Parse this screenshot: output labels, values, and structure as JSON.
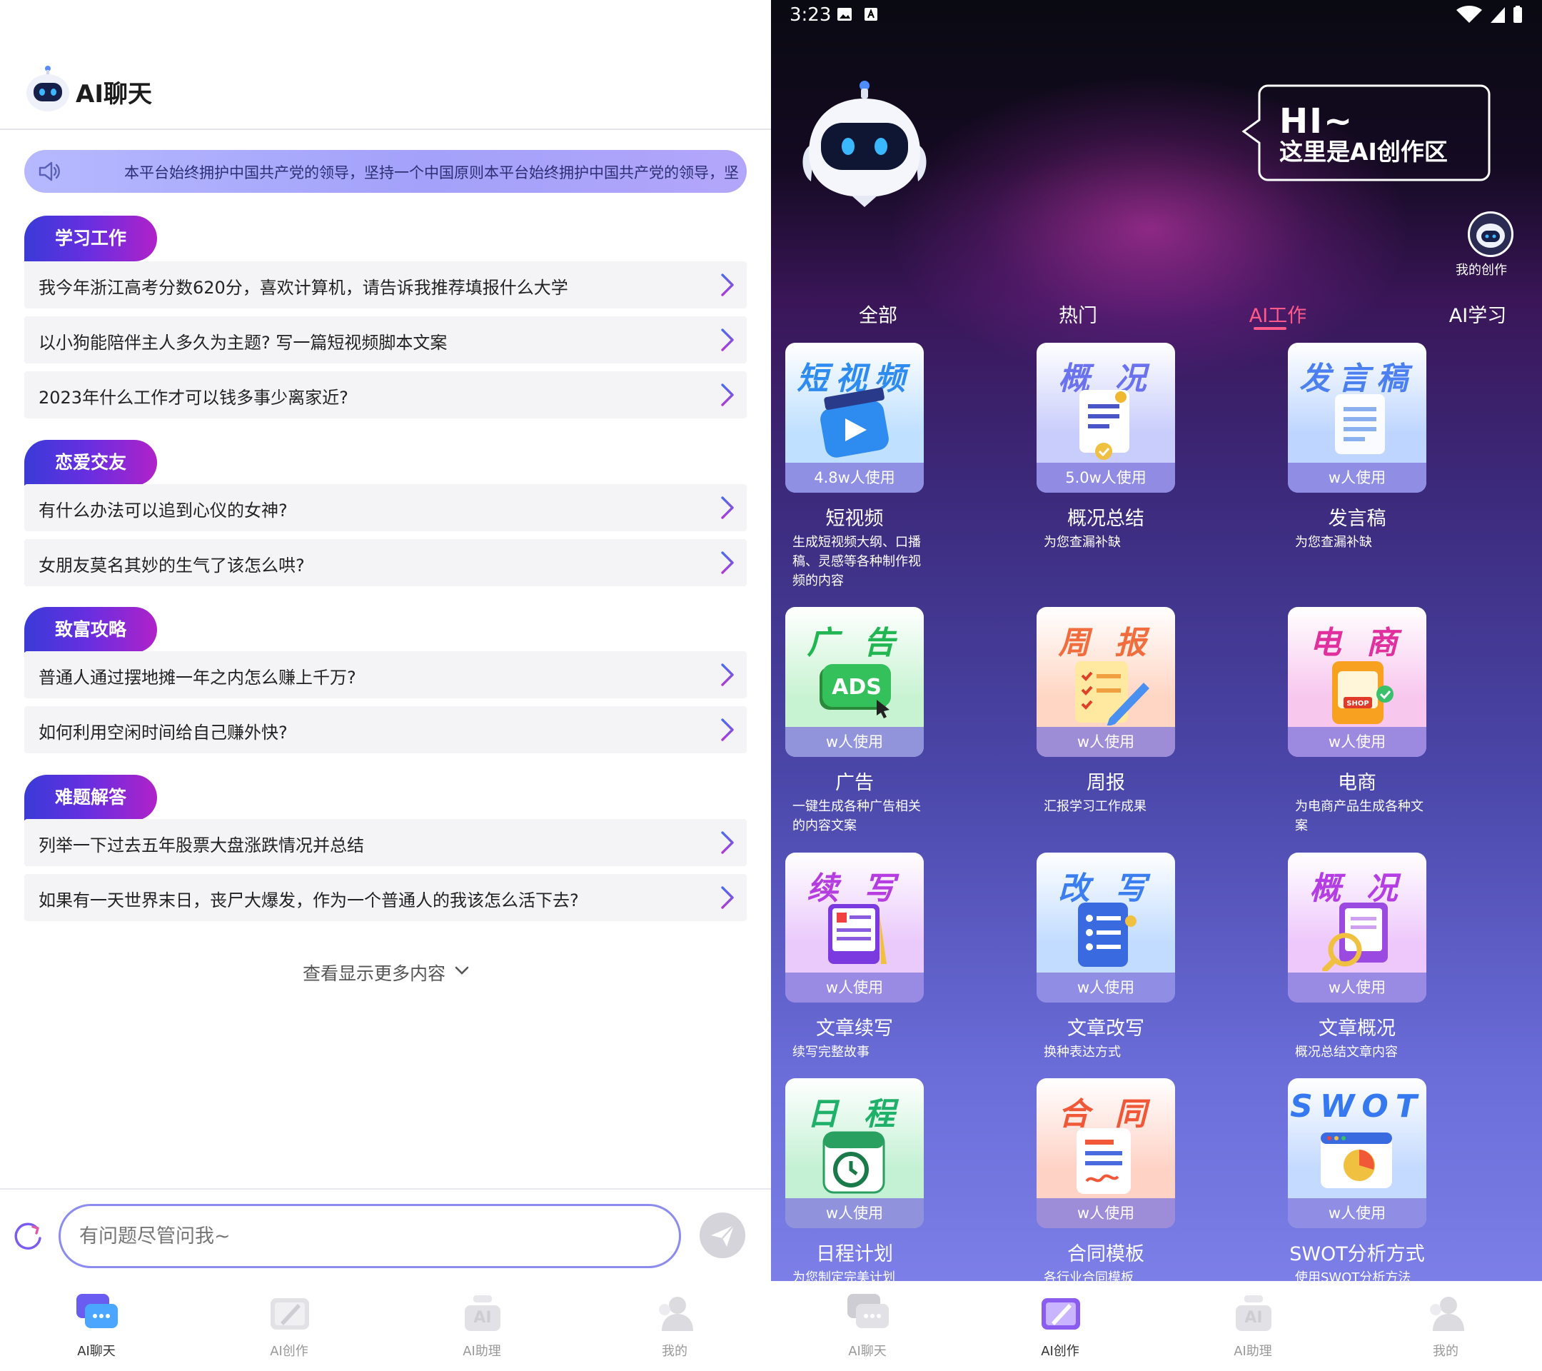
{
  "left": {
    "app_title": "AI聊天",
    "notice": "本平台始终拥护中国共产党的领导，坚持一个中国原则本平台始终拥护中国共产党的领导，坚",
    "categories": [
      {
        "name": "学习工作",
        "questions": [
          "我今年浙江高考分数620分，喜欢计算机，请告诉我推荐填报什么大学",
          "以小狗能陪伴主人多久为主题? 写一篇短视频脚本文案",
          "2023年什么工作才可以钱多事少离家近?"
        ]
      },
      {
        "name": "恋爱交友",
        "questions": [
          "有什么办法可以追到心仪的女神?",
          "女朋友莫名其妙的生气了该怎么哄?"
        ]
      },
      {
        "name": "致富攻略",
        "questions": [
          "普通人通过摆地摊一年之内怎么赚上千万?",
          "如何利用空闲时间给自己赚外快?"
        ]
      },
      {
        "name": "难题解答",
        "questions": [
          "列举一下过去五年股票大盘涨跌情况并总结",
          "如果有一天世界末日，丧尸大爆发，作为一个普通人的我该怎么活下去?"
        ]
      }
    ],
    "more": "查看显示更多内容",
    "input_placeholder": "有问题尽管问我~",
    "tabs": [
      "AI聊天",
      "AI创作",
      "AI助理",
      "我的"
    ],
    "active_tab": 0
  },
  "right": {
    "status_time": "3:23",
    "greeting": "HI~",
    "greeting_sub": "这里是AI创作区",
    "my_work": "我的创作",
    "category_tabs": [
      "全部",
      "热门",
      "AI工作",
      "AI学习"
    ],
    "active_category": 2,
    "cards": [
      {
        "header": "短视频",
        "usage": "4.8w人使用",
        "name": "短视频",
        "desc": "生成短视频大纲、口播稿、灵感等各种制作视频的内容",
        "icon": "video-play-icon",
        "bg": "#bfe0ff",
        "hd": "#2e8bf0"
      },
      {
        "header": "概 况",
        "usage": "5.0w人使用",
        "name": "概况总结",
        "desc": "为您查漏补缺",
        "icon": "document-check-icon",
        "bg": "#c9cdfb",
        "hd": "#6a72ee"
      },
      {
        "header": "发言稿",
        "usage": "w人使用",
        "name": "发言稿",
        "desc": "为您查漏补缺",
        "icon": "speech-paper-icon",
        "bg": "#bed6ff",
        "hd": "#4c80f0"
      },
      {
        "header": "广 告",
        "usage": "w人使用",
        "name": "广告",
        "desc": "一键生成各种广告相关的内容文案",
        "icon": "ads-icon",
        "bg": "#c8f3d2",
        "hd": "#22b652"
      },
      {
        "header": "周 报",
        "usage": "w人使用",
        "name": "周报",
        "desc": "汇报学习工作成果",
        "icon": "checklist-pen-icon",
        "bg": "#ffd6c4",
        "hd": "#f26d3d"
      },
      {
        "header": "电 商",
        "usage": "w人使用",
        "name": "电商",
        "desc": "为电商产品生成各种文案",
        "icon": "shop-icon",
        "bg": "#f8c7ee",
        "hd": "#e0309e"
      },
      {
        "header": "续 写",
        "usage": "w人使用",
        "name": "文章续写",
        "desc": "续写完整故事",
        "icon": "scroll-write-icon",
        "bg": "#eac9fb",
        "hd": "#b53ce0"
      },
      {
        "header": "改 写",
        "usage": "w人使用",
        "name": "文章改写",
        "desc": "换种表达方式",
        "icon": "rewrite-list-icon",
        "bg": "#c2dcff",
        "hd": "#3b7ef0"
      },
      {
        "header": "概 况",
        "usage": "w人使用",
        "name": "文章概况",
        "desc": "概况总结文章内容",
        "icon": "magnifier-doc-icon",
        "bg": "#eec8fb",
        "hd": "#b43ee4"
      },
      {
        "header": "日 程",
        "usage": "w人使用",
        "name": "日程计划",
        "desc": "为您制定完美计划",
        "icon": "calendar-clock-icon",
        "bg": "#c4f1d4",
        "hd": "#1fb06a"
      },
      {
        "header": "合 同",
        "usage": "w人使用",
        "name": "合同模板",
        "desc": "各行业合同模板",
        "icon": "contract-icon",
        "bg": "#ffd2c6",
        "hd": "#f05838"
      },
      {
        "header": "SWOT",
        "usage": "w人使用",
        "name": "SWOT分析方式",
        "desc": "使用SWOT分析方法",
        "icon": "swot-chart-icon",
        "bg": "#c4daff",
        "hd": "#3578f0"
      }
    ],
    "tabs": [
      "AI聊天",
      "AI创作",
      "AI助理",
      "我的"
    ],
    "active_tab": 1
  }
}
